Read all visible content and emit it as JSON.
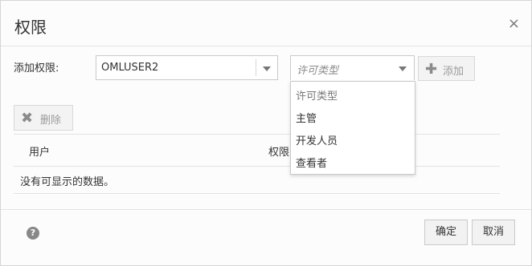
{
  "dialog": {
    "title": "权限",
    "close_icon": "×"
  },
  "form": {
    "add_label": "添加权限:",
    "user_select_value": "OMLUSER2",
    "type_select_placeholder": "许可类型",
    "add_button_label": "添加",
    "add_button_icon": "✚",
    "type_options": [
      "许可类型",
      "主管",
      "开发人员",
      "查看者"
    ]
  },
  "toolbar": {
    "delete_label": "删除",
    "delete_icon": "✖"
  },
  "table": {
    "columns": [
      "用户",
      "权限"
    ],
    "empty_message": "没有可显示的数据。"
  },
  "footer": {
    "help_icon": "?",
    "ok_label": "确定",
    "cancel_label": "取消"
  }
}
